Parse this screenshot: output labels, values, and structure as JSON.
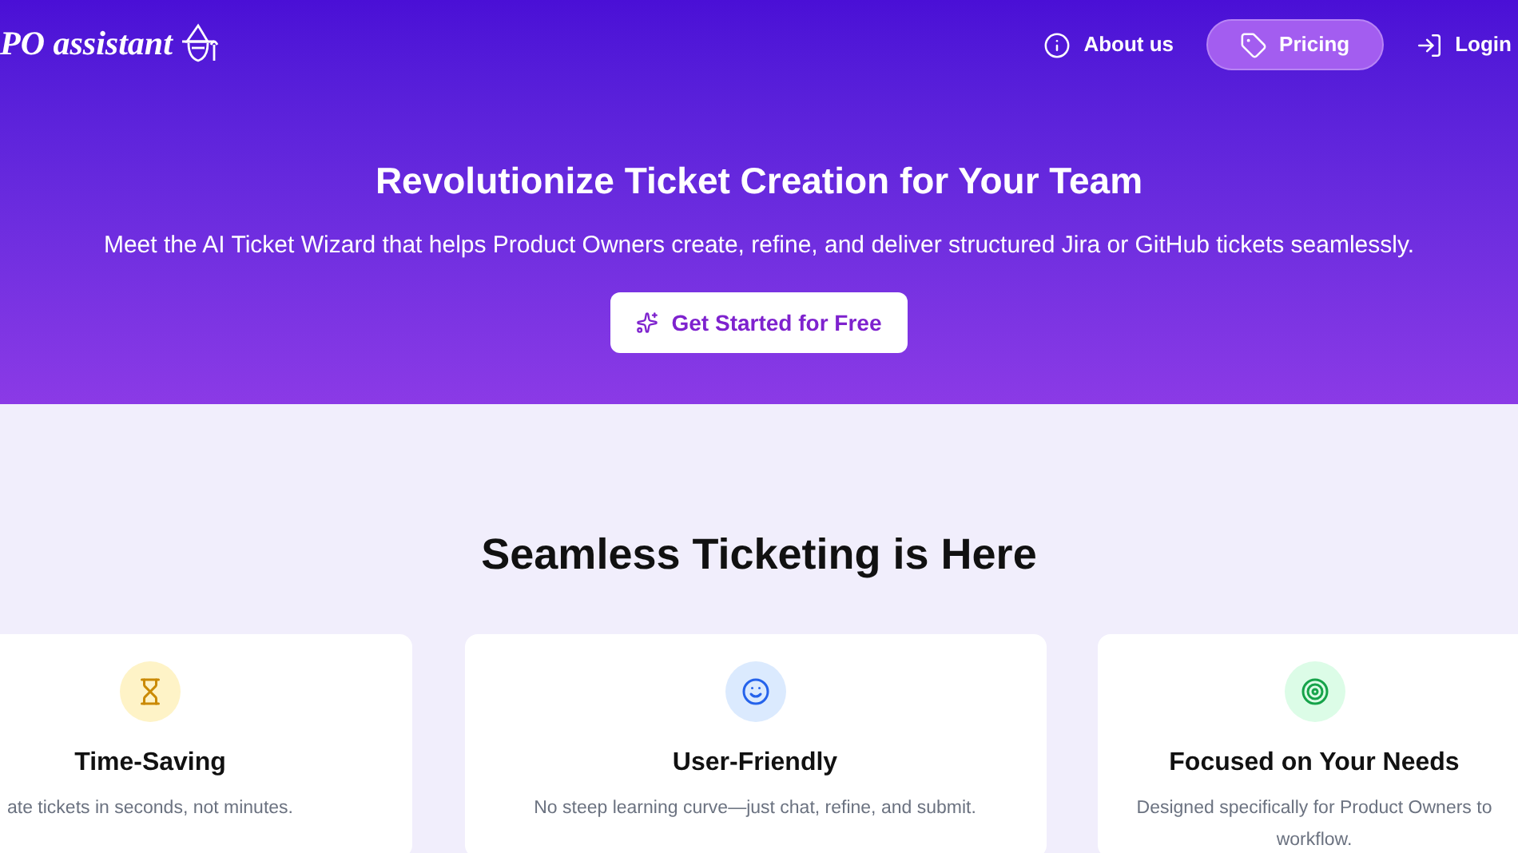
{
  "logo": {
    "text": "PO assistant"
  },
  "nav": [
    {
      "label": "About us",
      "kind": "info",
      "selected": false
    },
    {
      "label": "Pricing",
      "kind": "tag",
      "selected": true
    },
    {
      "label": "Login",
      "kind": "login",
      "selected": false
    }
  ],
  "hero": {
    "title": "Revolutionize Ticket Creation for Your Team",
    "subtitle": "Meet the AI Ticket Wizard that helps Product Owners create, refine, and deliver structured Jira or GitHub tickets seamlessly.",
    "cta": "Get Started for Free"
  },
  "features": {
    "heading": "Seamless Ticketing is Here",
    "cards": [
      {
        "kind": "hourglass",
        "color": "#fef3c7",
        "title": "Time-Saving",
        "lines": [
          "ate tickets in seconds, not minutes."
        ]
      },
      {
        "kind": "smile",
        "color": "#dbeafe",
        "title": "User-Friendly",
        "lines": [
          "No steep learning curve—just chat, refine, and submit."
        ]
      },
      {
        "kind": "target",
        "color": "#dcfce7",
        "title": "Focused on Your Needs",
        "lines": [
          "Designed specifically for Product Owners to",
          "workflow."
        ]
      }
    ]
  }
}
